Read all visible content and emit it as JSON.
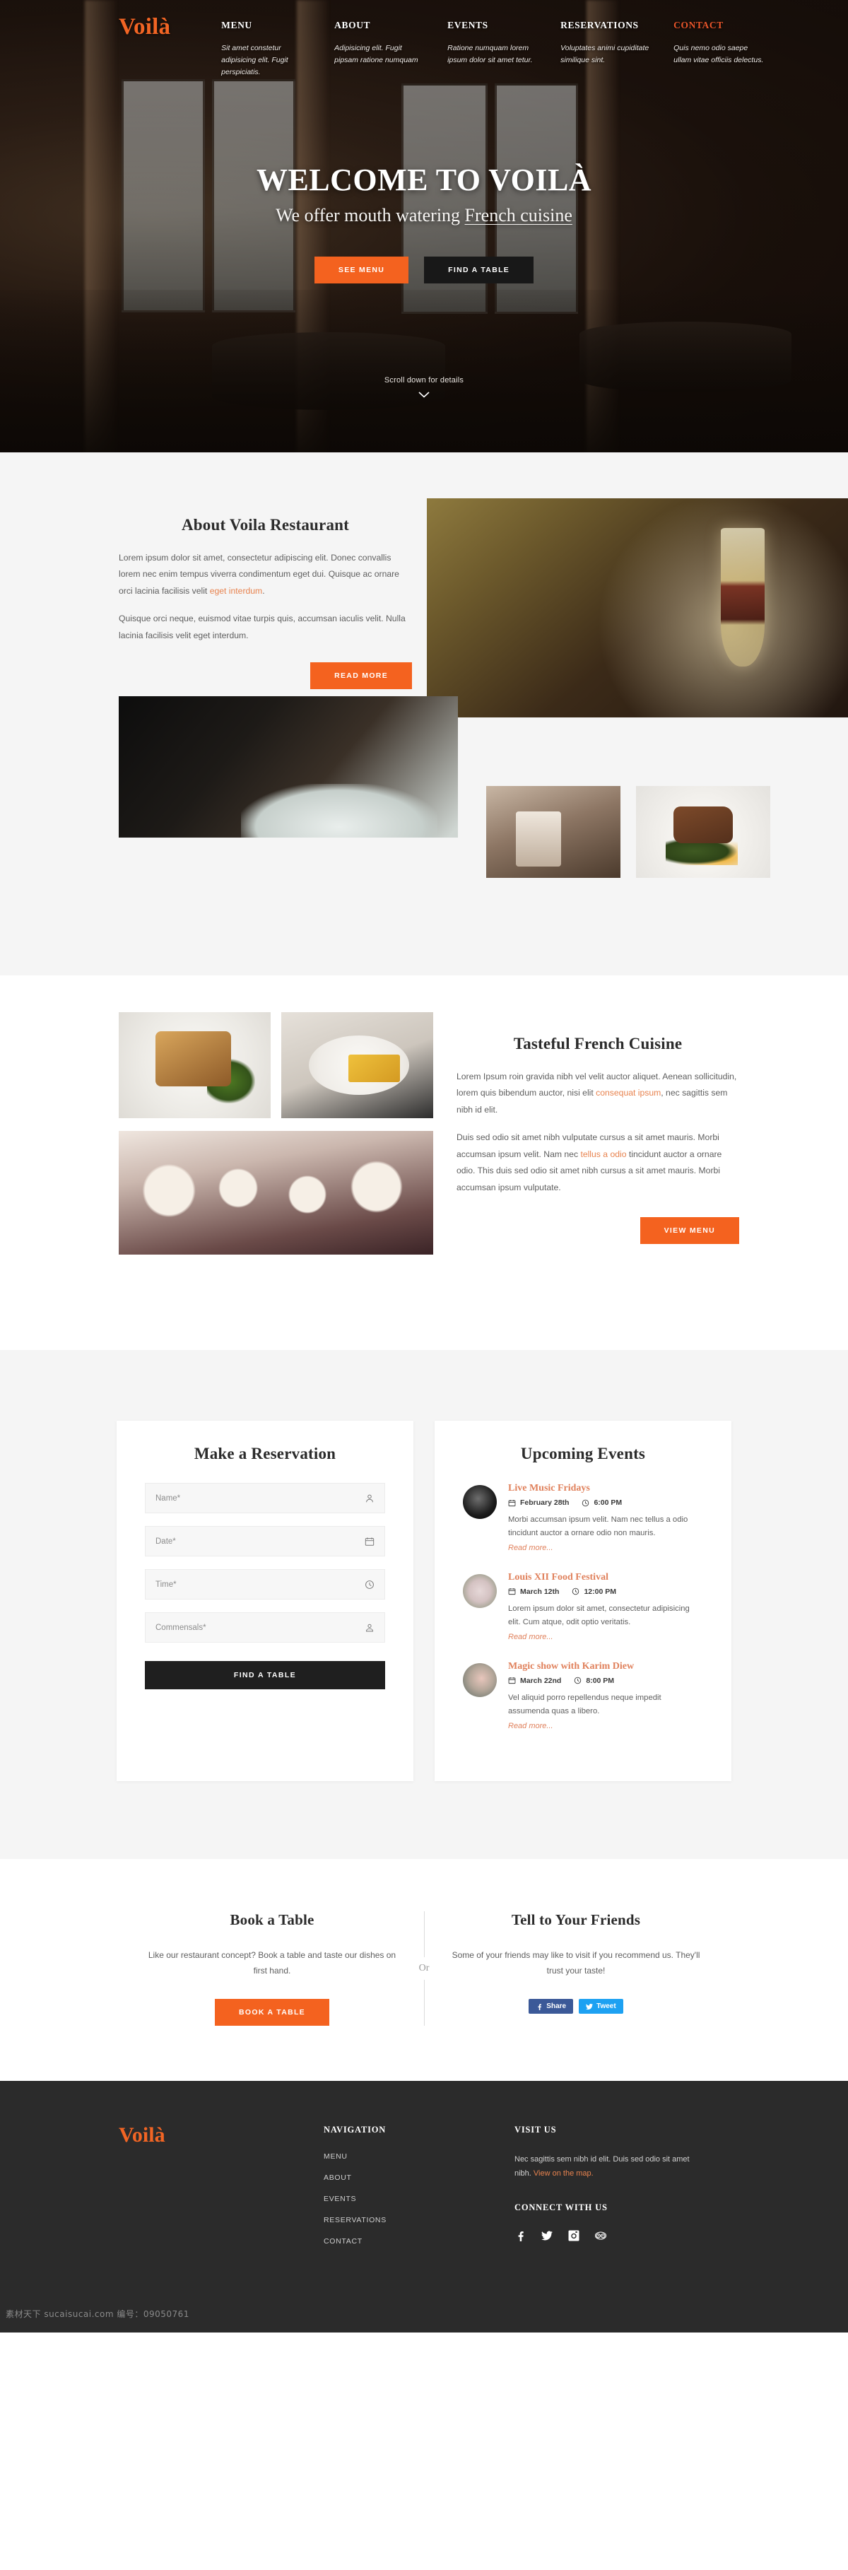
{
  "brand": {
    "name": "Voilà",
    "color": "#f26524"
  },
  "nav": {
    "columns": [
      {
        "label": "MENU",
        "sub": "Sit amet constetur adipisicing elit. Fugit perspiciatis.",
        "accent": false
      },
      {
        "label": "ABOUT",
        "sub": "Adipisicing elit. Fugit pipsam ratione numquam",
        "accent": false
      },
      {
        "label": "EVENTS",
        "sub": "Ratione numquam lorem ipsum dolor sit amet tetur.",
        "accent": false
      },
      {
        "label": "RESERVATIONS",
        "sub": "Voluptates animi cupiditate similique sint.",
        "accent": false
      },
      {
        "label": "CONTACT",
        "sub": "Quis nemo odio saepe ullam vitae officiis delectus.",
        "accent": true
      }
    ]
  },
  "hero": {
    "title": "WELCOME TO VOILÀ",
    "subtitle_pre": "We offer mouth watering ",
    "subtitle_underline": "French cuisine",
    "btn_primary": "SEE MENU",
    "btn_secondary": "FIND A TABLE",
    "scroll_text": "Scroll down for details",
    "scroll_chevron": "❯"
  },
  "about": {
    "title": "About Voila Restaurant",
    "p1_a": "Lorem ipsum dolor sit amet, consectetur adipiscing elit. Donec convallis lorem nec enim tempus viverra condimentum eget dui. Quisque ac ornare orci lacinia facilisis velit ",
    "p1_link": "eget interdum",
    "p1_b": ".",
    "p2": "Quisque orci neque, euismod vitae turpis quis, accumsan iaculis velit. Nulla lacinia facilisis velit eget interdum.",
    "button": "READ MORE"
  },
  "cuisine": {
    "title": "Tasteful French Cuisine",
    "p1_a": "Lorem Ipsum roin gravida nibh vel velit auctor aliquet. Aenean sollicitudin, lorem quis bibendum auctor, nisi elit ",
    "p1_link": "consequat ipsum",
    "p1_b": ", nec sagittis sem nibh id elit.",
    "p2_a": "Duis sed odio sit amet nibh vulputate cursus a sit amet mauris. Morbi accumsan ipsum velit. Nam nec ",
    "p2_link": "tellus a odio",
    "p2_b": " tincidunt auctor a ornare odio. This duis sed odio sit amet nibh cursus a sit amet mauris. Morbi accumsan ipsum vulputate.",
    "button": "VIEW MENU"
  },
  "reservation": {
    "title": "Make a Reservation",
    "fields": [
      {
        "placeholder": "Name*",
        "icon": "person-icon"
      },
      {
        "placeholder": "Date*",
        "icon": "calendar-icon"
      },
      {
        "placeholder": "Time*",
        "icon": "clock-icon"
      },
      {
        "placeholder": "Commensals*",
        "icon": "people-icon"
      }
    ],
    "submit": "FIND A TABLE"
  },
  "events": {
    "title": "Upcoming Events",
    "read_more": "Read more...",
    "items": [
      {
        "title": "Live Music Fridays",
        "date": "February 28th",
        "time": "6:00 PM",
        "desc": "Morbi accumsan ipsum velit. Nam nec tellus a odio tincidunt auctor a ornare odio non mauris."
      },
      {
        "title": "Louis XII Food Festival",
        "date": "March 12th",
        "time": "12:00 PM",
        "desc": "Lorem ipsum dolor sit amet, consectetur adipisicing elit. Cum atque, odit optio veritatis."
      },
      {
        "title": "Magic show with Karim Diew",
        "date": "March 22nd",
        "time": "8:00 PM",
        "desc": "Vel aliquid porro repellendus neque impedit assumenda quas a libero."
      }
    ]
  },
  "cta": {
    "left_title": "Book a Table",
    "left_text": "Like our restaurant concept? Book a table and taste our dishes on first hand.",
    "left_button": "BOOK A TABLE",
    "divider": "Or",
    "right_title": "Tell to Your Friends",
    "right_text": "Some of your friends may like to visit if you recommend us. They'll trust your taste!",
    "share_label": "Share",
    "tweet_label": "Tweet"
  },
  "footer": {
    "brand": "Voilà",
    "nav_head": "NAVIGATION",
    "nav_links": [
      "MENU",
      "ABOUT",
      "EVENTS",
      "RESERVATIONS",
      "CONTACT"
    ],
    "visit_head": "VISIT US",
    "visit_text_a": "Nec sagittis sem nibh id elit. Duis sed odio sit amet nibh. ",
    "visit_link": "View on the map.",
    "connect_head": "CONNECT WITH US",
    "socials": [
      "facebook-icon",
      "twitter-icon",
      "instagram-icon",
      "tripadvisor-icon"
    ]
  },
  "watermark": "素材天下 sucaisucai.com  编号：09050761"
}
